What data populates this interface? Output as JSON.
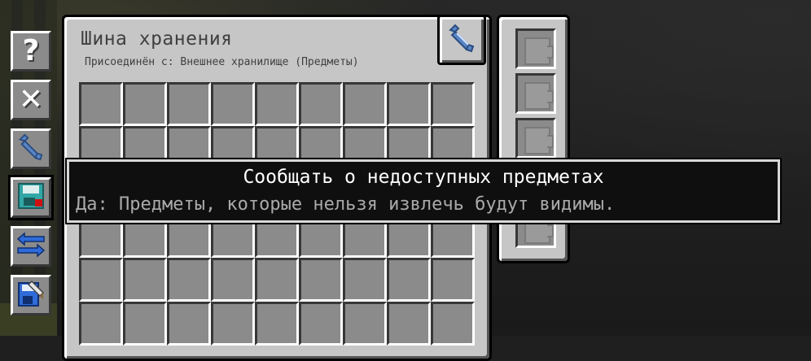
{
  "window": {
    "title": "Шина хранения",
    "subtitle": "Присоединён с: Внешнее хранилище (Предметы)"
  },
  "grid": {
    "columns": 9,
    "rows": 6
  },
  "toolbar": {
    "items": [
      {
        "name": "help-button",
        "icon": "question-mark-icon",
        "glyph": "?"
      },
      {
        "name": "clear-button",
        "icon": "close-icon",
        "glyph": "✕"
      },
      {
        "name": "wrench-button",
        "icon": "wrench-icon"
      },
      {
        "name": "report-unavailable-button",
        "icon": "floppy-disk-red-icon"
      },
      {
        "name": "transfer-direction-button",
        "icon": "blue-arrows-icon"
      },
      {
        "name": "save-config-button",
        "icon": "floppy-disk-pen-icon"
      }
    ]
  },
  "side_panel": {
    "slots": 5,
    "ghost_icon": "upgrade-card-icon"
  },
  "tooltip": {
    "title": "Сообщать о недоступных предметах",
    "description": "Да: Предметы, которые нельзя извлечь будут видимы."
  },
  "colors": {
    "panel": "#c6c6c6",
    "slot": "#8b8b8b",
    "tooltip_bg": "#0f0f10",
    "tooltip_title": "#ffffff",
    "tooltip_desc": "#aaaaaa",
    "arrow_blue": "#2f6bd9",
    "disk_red": "#d01010",
    "disk_teal": "#32a7a7"
  }
}
